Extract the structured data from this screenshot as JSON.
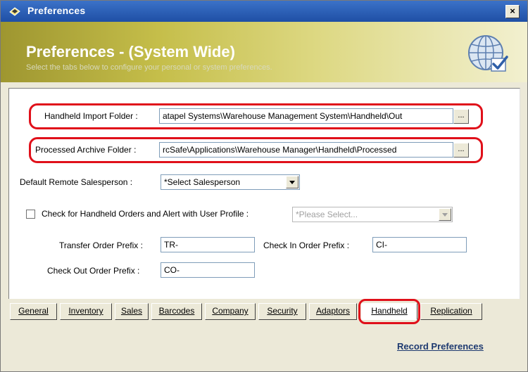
{
  "window": {
    "title": "Preferences",
    "close_label": "×"
  },
  "banner": {
    "title": "Preferences - (System Wide)",
    "subtitle": "Select the tabs below to configure your personal or system preferences."
  },
  "form": {
    "import_folder": {
      "label": "Handheld Import Folder :",
      "value": "atapel Systems\\Warehouse Management System\\Handheld\\Out",
      "browse_label": "..."
    },
    "archive_folder": {
      "label": "Processed Archive Folder :",
      "value": "rcSafe\\Applications\\Warehouse Manager\\Handheld\\Processed",
      "browse_label": "..."
    },
    "salesperson": {
      "label": "Default Remote Salesperson :",
      "value": "*Select Salesperson"
    },
    "check_orders": {
      "label": "Check for Handheld Orders and Alert with User Profile :",
      "checked": false,
      "placeholder": "*Please Select..."
    },
    "transfer_prefix": {
      "label": "Transfer Order Prefix :",
      "value": "TR-"
    },
    "checkin_prefix": {
      "label": "Check In Order  Prefix :",
      "value": "CI-"
    },
    "checkout_prefix": {
      "label": "Check Out Order Prefix :",
      "value": "CO-"
    }
  },
  "tabs": [
    {
      "label": "General"
    },
    {
      "label": "Inventory"
    },
    {
      "label": "Sales"
    },
    {
      "label": "Barcodes"
    },
    {
      "label": "Company"
    },
    {
      "label": "Security"
    },
    {
      "label": "Adaptors"
    },
    {
      "label": "Handheld",
      "active": true
    },
    {
      "label": "Replication"
    }
  ],
  "footer": {
    "record_label": "Record Preferences"
  },
  "colors": {
    "highlight": "#e0101a",
    "titlebar": "#2a5cb8",
    "link": "#1e3a70"
  }
}
